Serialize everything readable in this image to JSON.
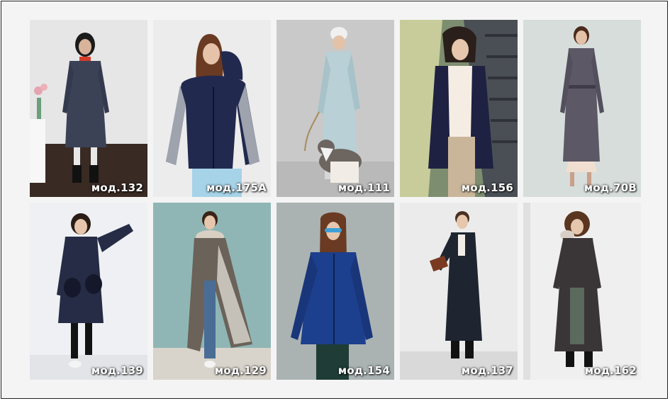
{
  "catalog": {
    "items": [
      {
        "label": "мод.132",
        "photo": "woman in navy quilted long coat, red sweater, studio with tulips",
        "bg": "#dcdcdc",
        "coat": "#3b4256"
      },
      {
        "label": "мод.175А",
        "photo": "woman in navy quilted vest with grey knit sleeves",
        "bg": "#e9e9e9",
        "coat": "#22294f"
      },
      {
        "label": "мод.111",
        "photo": "woman in pale blue long puffer coat with husky dog",
        "bg": "#c9c9c9",
        "coat": "#b8d0d6"
      },
      {
        "label": "мод.156",
        "photo": "woman in dark navy glossy jacket on escalator",
        "bg": "#8a9a7a",
        "coat": "#1f2142"
      },
      {
        "label": "мод.70В",
        "photo": "woman in long grey quilted belted coat",
        "bg": "#d8dedc",
        "coat": "#5c5866"
      },
      {
        "label": "мод.139",
        "photo": "woman in navy hooded coat with fur pockets",
        "bg": "#eceef2",
        "coat": "#262c45"
      },
      {
        "label": "мод.129",
        "photo": "woman in long grey quilted coat with fur collar",
        "bg": "#8fb6b4",
        "coat": "#6b6259"
      },
      {
        "label": "мод.154",
        "photo": "woman in bright blue glossy jacket, sunglasses",
        "bg": "#a9b3b2",
        "coat": "#1c3f8e"
      },
      {
        "label": "мод.137",
        "photo": "woman in long black textured coat holding a book",
        "bg": "#e8e8e8",
        "coat": "#1e2530"
      },
      {
        "label": "мод.162",
        "photo": "woman in long dark quilted coat with fur collar",
        "bg": "#efefef",
        "coat": "#3a3536"
      }
    ]
  }
}
